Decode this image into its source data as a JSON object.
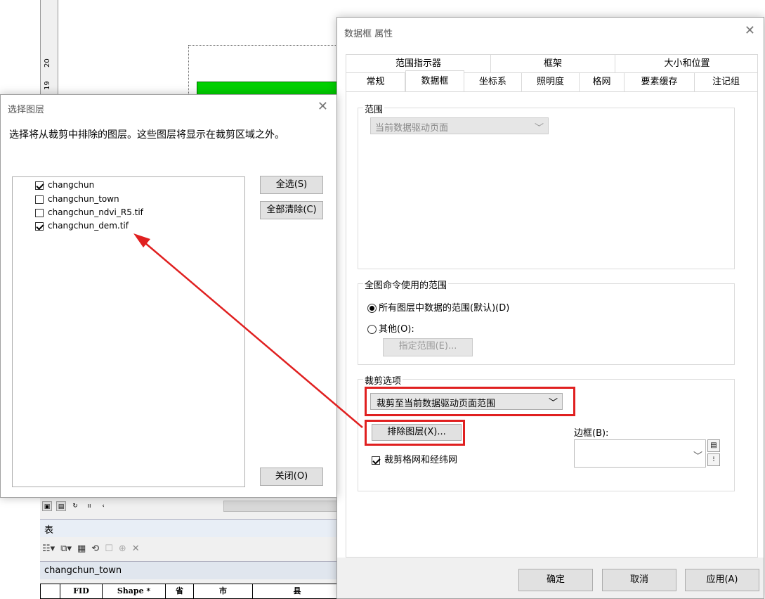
{
  "background": {
    "ruler_numbers": [
      "20",
      "19"
    ],
    "table_panel_title": "表",
    "table_name": "changchun_town",
    "columns": [
      "FID",
      "Shape *",
      "省",
      "市",
      "县"
    ]
  },
  "select_layers_dialog": {
    "title": "选择图层",
    "instruction": "选择将从裁剪中排除的图层。这些图层将显示在裁剪区域之外。",
    "layers": [
      {
        "name": "changchun",
        "checked": true
      },
      {
        "name": "changchun_town",
        "checked": false
      },
      {
        "name": "changchun_ndvi_R5.tif",
        "checked": false
      },
      {
        "name": "changchun_dem.tif",
        "checked": true
      }
    ],
    "select_all_label": "全选(S)",
    "clear_all_label": "全部清除(C)",
    "close_label": "关闭(O)"
  },
  "dataframe_dialog": {
    "title": "数据框 属性",
    "tabs_row1": [
      "范围指示器",
      "框架",
      "大小和位置"
    ],
    "tabs_row2": [
      "常规",
      "数据框",
      "坐标系",
      "照明度",
      "格网",
      "要素缓存",
      "注记组"
    ],
    "active_tab": "数据框",
    "extent_group": {
      "label": "范围",
      "dropdown_value": "当前数据驱动页面"
    },
    "full_extent_group": {
      "label": "全图命令使用的范围",
      "radio_all": "所有图层中数据的范围(默认)(D)",
      "radio_other": "其他(O):",
      "specify_button": "指定范围(E)..."
    },
    "clip_group": {
      "label": "裁剪选项",
      "dropdown_value": "裁剪至当前数据驱动页面范围",
      "exclude_button": "排除图层(X)...",
      "border_label": "边框(B):",
      "clip_grids_label": "裁剪格网和经纬网",
      "clip_grids_checked": true
    },
    "ok_label": "确定",
    "cancel_label": "取消",
    "apply_label": "应用(A)"
  },
  "colors": {
    "highlight_red": "#e02020",
    "map_green": "#00d000"
  }
}
